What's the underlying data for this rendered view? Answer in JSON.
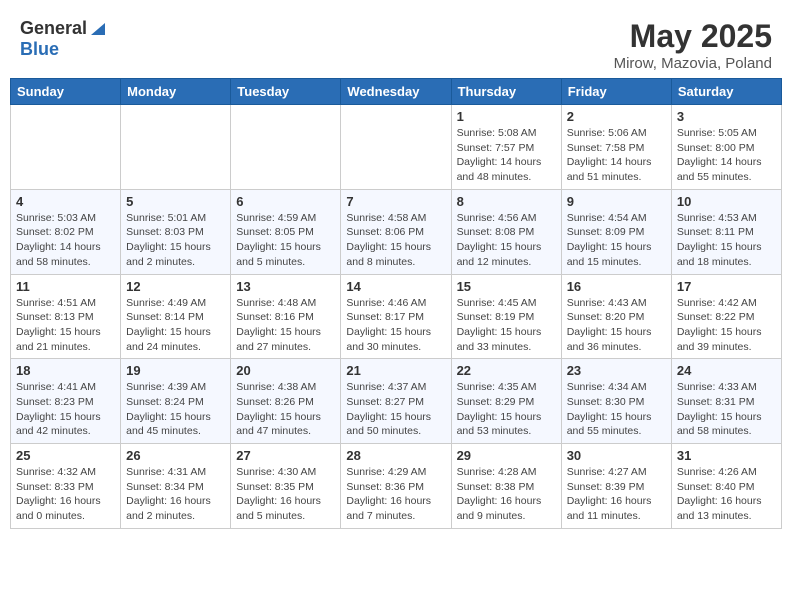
{
  "header": {
    "logo_general": "General",
    "logo_blue": "Blue",
    "month_year": "May 2025",
    "location": "Mirow, Mazovia, Poland"
  },
  "days_of_week": [
    "Sunday",
    "Monday",
    "Tuesday",
    "Wednesday",
    "Thursday",
    "Friday",
    "Saturday"
  ],
  "weeks": [
    [
      {
        "day": "",
        "info": ""
      },
      {
        "day": "",
        "info": ""
      },
      {
        "day": "",
        "info": ""
      },
      {
        "day": "",
        "info": ""
      },
      {
        "day": "1",
        "info": "Sunrise: 5:08 AM\nSunset: 7:57 PM\nDaylight: 14 hours\nand 48 minutes."
      },
      {
        "day": "2",
        "info": "Sunrise: 5:06 AM\nSunset: 7:58 PM\nDaylight: 14 hours\nand 51 minutes."
      },
      {
        "day": "3",
        "info": "Sunrise: 5:05 AM\nSunset: 8:00 PM\nDaylight: 14 hours\nand 55 minutes."
      }
    ],
    [
      {
        "day": "4",
        "info": "Sunrise: 5:03 AM\nSunset: 8:02 PM\nDaylight: 14 hours\nand 58 minutes."
      },
      {
        "day": "5",
        "info": "Sunrise: 5:01 AM\nSunset: 8:03 PM\nDaylight: 15 hours\nand 2 minutes."
      },
      {
        "day": "6",
        "info": "Sunrise: 4:59 AM\nSunset: 8:05 PM\nDaylight: 15 hours\nand 5 minutes."
      },
      {
        "day": "7",
        "info": "Sunrise: 4:58 AM\nSunset: 8:06 PM\nDaylight: 15 hours\nand 8 minutes."
      },
      {
        "day": "8",
        "info": "Sunrise: 4:56 AM\nSunset: 8:08 PM\nDaylight: 15 hours\nand 12 minutes."
      },
      {
        "day": "9",
        "info": "Sunrise: 4:54 AM\nSunset: 8:09 PM\nDaylight: 15 hours\nand 15 minutes."
      },
      {
        "day": "10",
        "info": "Sunrise: 4:53 AM\nSunset: 8:11 PM\nDaylight: 15 hours\nand 18 minutes."
      }
    ],
    [
      {
        "day": "11",
        "info": "Sunrise: 4:51 AM\nSunset: 8:13 PM\nDaylight: 15 hours\nand 21 minutes."
      },
      {
        "day": "12",
        "info": "Sunrise: 4:49 AM\nSunset: 8:14 PM\nDaylight: 15 hours\nand 24 minutes."
      },
      {
        "day": "13",
        "info": "Sunrise: 4:48 AM\nSunset: 8:16 PM\nDaylight: 15 hours\nand 27 minutes."
      },
      {
        "day": "14",
        "info": "Sunrise: 4:46 AM\nSunset: 8:17 PM\nDaylight: 15 hours\nand 30 minutes."
      },
      {
        "day": "15",
        "info": "Sunrise: 4:45 AM\nSunset: 8:19 PM\nDaylight: 15 hours\nand 33 minutes."
      },
      {
        "day": "16",
        "info": "Sunrise: 4:43 AM\nSunset: 8:20 PM\nDaylight: 15 hours\nand 36 minutes."
      },
      {
        "day": "17",
        "info": "Sunrise: 4:42 AM\nSunset: 8:22 PM\nDaylight: 15 hours\nand 39 minutes."
      }
    ],
    [
      {
        "day": "18",
        "info": "Sunrise: 4:41 AM\nSunset: 8:23 PM\nDaylight: 15 hours\nand 42 minutes."
      },
      {
        "day": "19",
        "info": "Sunrise: 4:39 AM\nSunset: 8:24 PM\nDaylight: 15 hours\nand 45 minutes."
      },
      {
        "day": "20",
        "info": "Sunrise: 4:38 AM\nSunset: 8:26 PM\nDaylight: 15 hours\nand 47 minutes."
      },
      {
        "day": "21",
        "info": "Sunrise: 4:37 AM\nSunset: 8:27 PM\nDaylight: 15 hours\nand 50 minutes."
      },
      {
        "day": "22",
        "info": "Sunrise: 4:35 AM\nSunset: 8:29 PM\nDaylight: 15 hours\nand 53 minutes."
      },
      {
        "day": "23",
        "info": "Sunrise: 4:34 AM\nSunset: 8:30 PM\nDaylight: 15 hours\nand 55 minutes."
      },
      {
        "day": "24",
        "info": "Sunrise: 4:33 AM\nSunset: 8:31 PM\nDaylight: 15 hours\nand 58 minutes."
      }
    ],
    [
      {
        "day": "25",
        "info": "Sunrise: 4:32 AM\nSunset: 8:33 PM\nDaylight: 16 hours\nand 0 minutes."
      },
      {
        "day": "26",
        "info": "Sunrise: 4:31 AM\nSunset: 8:34 PM\nDaylight: 16 hours\nand 2 minutes."
      },
      {
        "day": "27",
        "info": "Sunrise: 4:30 AM\nSunset: 8:35 PM\nDaylight: 16 hours\nand 5 minutes."
      },
      {
        "day": "28",
        "info": "Sunrise: 4:29 AM\nSunset: 8:36 PM\nDaylight: 16 hours\nand 7 minutes."
      },
      {
        "day": "29",
        "info": "Sunrise: 4:28 AM\nSunset: 8:38 PM\nDaylight: 16 hours\nand 9 minutes."
      },
      {
        "day": "30",
        "info": "Sunrise: 4:27 AM\nSunset: 8:39 PM\nDaylight: 16 hours\nand 11 minutes."
      },
      {
        "day": "31",
        "info": "Sunrise: 4:26 AM\nSunset: 8:40 PM\nDaylight: 16 hours\nand 13 minutes."
      }
    ]
  ]
}
